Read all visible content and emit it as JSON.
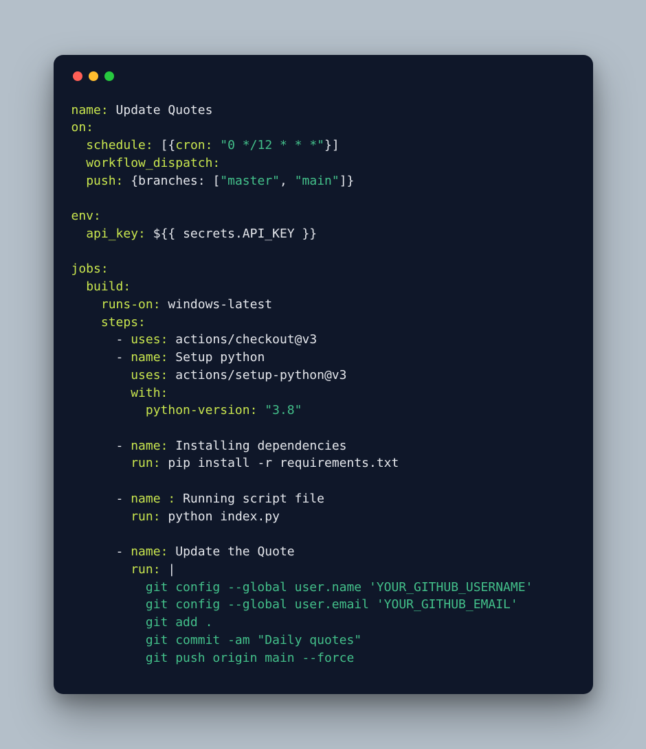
{
  "window_controls": {
    "close": "close",
    "min": "minimize",
    "max": "zoom"
  },
  "yaml": {
    "name_key": "name:",
    "name_val": "Update Quotes",
    "on_key": "on:",
    "schedule_key": "schedule:",
    "cron_key": "cron:",
    "cron_val": "\"0 */12 * * *\"",
    "workflow_dispatch_key": "workflow_dispatch:",
    "push_key": "push:",
    "branches_key": "branches:",
    "branch1": "\"master\"",
    "branch2": "\"main\"",
    "env_key": "env:",
    "api_key_key": "api_key:",
    "api_key_val": "${{ secrets.API_KEY }}",
    "jobs_key": "jobs:",
    "build_key": "build:",
    "runs_on_key": "runs-on:",
    "runs_on_val": "windows-latest",
    "steps_key": "steps:",
    "uses_key": "uses:",
    "checkout_val": "actions/checkout@v3",
    "step2_name_key": "name:",
    "step2_name_val": "Setup python",
    "step2_uses_val": "actions/setup-python@v3",
    "with_key": "with:",
    "py_ver_key": "python-version:",
    "py_ver_val": "\"3.8\"",
    "step3_name_key": "name:",
    "step3_name_val": "Installing dependencies",
    "run_key": "run:",
    "step3_run_val": "pip install -r requirements.txt",
    "step4_name_key": "name :",
    "step4_name_val": "Running script file",
    "step4_run_val": "python index.py",
    "step5_name_val": "Update the Quote",
    "pipe": "|",
    "cmd1": "git config --global user.name 'YOUR_GITHUB_USERNAME'",
    "cmd2": "git config --global user.email 'YOUR_GITHUB_EMAIL'",
    "cmd3": "git add .",
    "cmd4": "git commit -am \"Daily quotes\"",
    "cmd5": "git push origin main --force"
  }
}
